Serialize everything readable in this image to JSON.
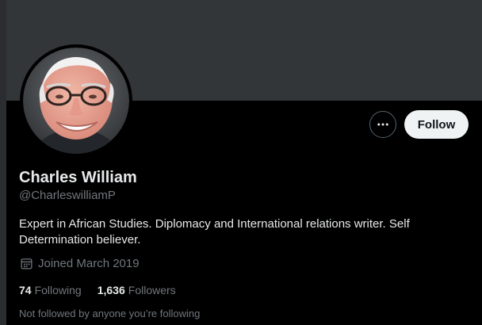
{
  "profile": {
    "display_name": "Charles William",
    "handle": "@CharleswilliamP",
    "bio": "Expert in African Studies. Diplomacy and International relations writer. Self Determination believer.",
    "joined": "Joined March 2019",
    "avatar_alt": "avatar"
  },
  "actions": {
    "more_icon": "more-horizontal-icon",
    "follow_label": "Follow"
  },
  "stats": {
    "following_count": "74",
    "following_label": "Following",
    "followers_count": "1,636",
    "followers_label": "Followers"
  },
  "mutuals_note": "Not followed by anyone you’re following",
  "colors": {
    "banner": "#333639",
    "background": "#000000",
    "text_primary": "#e7e9ea",
    "text_secondary": "#71767b",
    "follow_button_bg": "#eff3f4"
  }
}
